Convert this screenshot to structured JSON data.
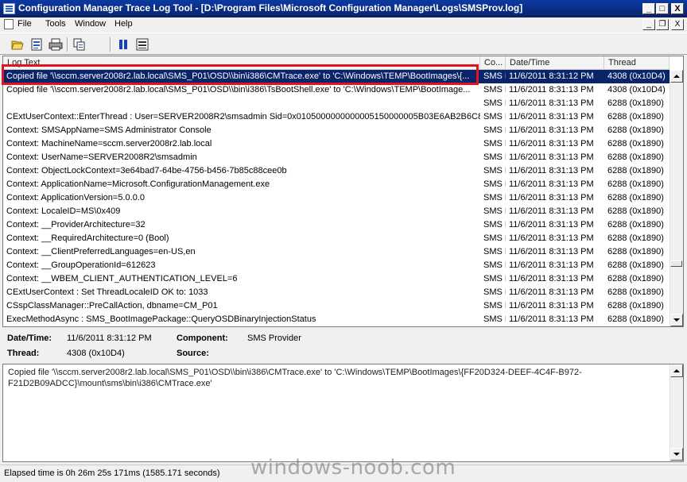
{
  "window": {
    "title": "Configuration Manager Trace Log Tool - [D:\\Program Files\\Microsoft Configuration Manager\\Logs\\SMSProv.log]",
    "controls": {
      "minimize": "_",
      "maximize": "□",
      "close": "X"
    }
  },
  "menu": {
    "items": [
      "File",
      "Tools",
      "Window",
      "Help"
    ],
    "mdi_controls": {
      "minimize": "_",
      "restore": "❐",
      "close": "X"
    }
  },
  "toolbar": {
    "icons": [
      "open-folder-icon",
      "open-list-icon",
      "print-icon",
      "copy-icon",
      "pause-icon",
      "highlight-icon"
    ]
  },
  "log": {
    "headers": {
      "text": "Log Text",
      "component": "Co...",
      "datetime": "Date/Time",
      "thread": "Thread"
    },
    "rows": [
      {
        "text": "Copied file '\\\\sccm.server2008r2.lab.local\\SMS_P01\\OSD\\\\bin\\i386\\CMTrace.exe' to 'C:\\Windows\\TEMP\\BootImages\\{...",
        "component": "SMS F",
        "datetime": "11/6/2011 8:31:12 PM",
        "thread": "4308 (0x10D4)",
        "selected": true
      },
      {
        "text": "Copied file '\\\\sccm.server2008r2.lab.local\\SMS_P01\\OSD\\\\bin\\i386\\TsBootShell.exe' to 'C:\\Windows\\TEMP\\BootImage...",
        "component": "SMS F",
        "datetime": "11/6/2011 8:31:13 PM",
        "thread": "4308 (0x10D4)"
      },
      {
        "text": "",
        "component": "SMS F",
        "datetime": "11/6/2011 8:31:13 PM",
        "thread": "6288 (0x1890)"
      },
      {
        "text": "CExtUserContext::EnterThread : User=SERVER2008R2\\smsadmin Sid=0x0105000000000005150000005B03E6AB2B6C8...",
        "component": "SMS F",
        "datetime": "11/6/2011 8:31:13 PM",
        "thread": "6288 (0x1890)"
      },
      {
        "text": "Context: SMSAppName=SMS Administrator Console",
        "component": "SMS F",
        "datetime": "11/6/2011 8:31:13 PM",
        "thread": "6288 (0x1890)"
      },
      {
        "text": "Context: MachineName=sccm.server2008r2.lab.local",
        "component": "SMS F",
        "datetime": "11/6/2011 8:31:13 PM",
        "thread": "6288 (0x1890)"
      },
      {
        "text": "Context: UserName=SERVER2008R2\\smsadmin",
        "component": "SMS F",
        "datetime": "11/6/2011 8:31:13 PM",
        "thread": "6288 (0x1890)"
      },
      {
        "text": "Context: ObjectLockContext=3e64bad7-64be-4756-b456-7b85c88cee0b",
        "component": "SMS F",
        "datetime": "11/6/2011 8:31:13 PM",
        "thread": "6288 (0x1890)"
      },
      {
        "text": "Context: ApplicationName=Microsoft.ConfigurationManagement.exe",
        "component": "SMS F",
        "datetime": "11/6/2011 8:31:13 PM",
        "thread": "6288 (0x1890)"
      },
      {
        "text": "Context: ApplicationVersion=5.0.0.0",
        "component": "SMS F",
        "datetime": "11/6/2011 8:31:13 PM",
        "thread": "6288 (0x1890)"
      },
      {
        "text": "Context: LocaleID=MS\\0x409",
        "component": "SMS F",
        "datetime": "11/6/2011 8:31:13 PM",
        "thread": "6288 (0x1890)"
      },
      {
        "text": "Context: __ProviderArchitecture=32",
        "component": "SMS F",
        "datetime": "11/6/2011 8:31:13 PM",
        "thread": "6288 (0x1890)"
      },
      {
        "text": "Context: __RequiredArchitecture=0 (Bool)",
        "component": "SMS F",
        "datetime": "11/6/2011 8:31:13 PM",
        "thread": "6288 (0x1890)"
      },
      {
        "text": "Context: __ClientPreferredLanguages=en-US,en",
        "component": "SMS F",
        "datetime": "11/6/2011 8:31:13 PM",
        "thread": "6288 (0x1890)"
      },
      {
        "text": "Context: __GroupOperationId=612623",
        "component": "SMS F",
        "datetime": "11/6/2011 8:31:13 PM",
        "thread": "6288 (0x1890)"
      },
      {
        "text": "Context: __WBEM_CLIENT_AUTHENTICATION_LEVEL=6",
        "component": "SMS F",
        "datetime": "11/6/2011 8:31:13 PM",
        "thread": "6288 (0x1890)"
      },
      {
        "text": "CExtUserContext : Set ThreadLocaleID OK to: 1033",
        "component": "SMS F",
        "datetime": "11/6/2011 8:31:13 PM",
        "thread": "6288 (0x1890)"
      },
      {
        "text": "CSspClassManager::PreCallAction, dbname=CM_P01",
        "component": "SMS F",
        "datetime": "11/6/2011 8:31:13 PM",
        "thread": "6288 (0x1890)"
      },
      {
        "text": "ExecMethodAsync : SMS_BootImagePackage::QueryOSDBinaryInjectionStatus",
        "component": "SMS F",
        "datetime": "11/6/2011 8:31:13 PM",
        "thread": "6288 (0x1890)"
      }
    ]
  },
  "details": {
    "datetime_label": "Date/Time:",
    "datetime_value": "11/6/2011 8:31:12 PM",
    "component_label": "Component:",
    "component_value": "SMS Provider",
    "thread_label": "Thread:",
    "thread_value": "4308 (0x10D4)",
    "source_label": "Source:",
    "source_value": ""
  },
  "message": "Copied file '\\\\sccm.server2008r2.lab.local\\SMS_P01\\OSD\\\\bin\\i386\\CMTrace.exe' to 'C:\\Windows\\TEMP\\BootImages\\{FF20D324-DEEF-4C4F-B972-F21D2B09ADCC}\\mount\\sms\\bin\\i386\\CMTrace.exe'",
  "status": "Elapsed time is 0h 26m 25s 171ms (1585.171 seconds)",
  "watermark": "windows-noob.com",
  "colors": {
    "titlebar": "#0a246a",
    "selection": "#0a246a",
    "highlight_box": "#e0141e"
  }
}
